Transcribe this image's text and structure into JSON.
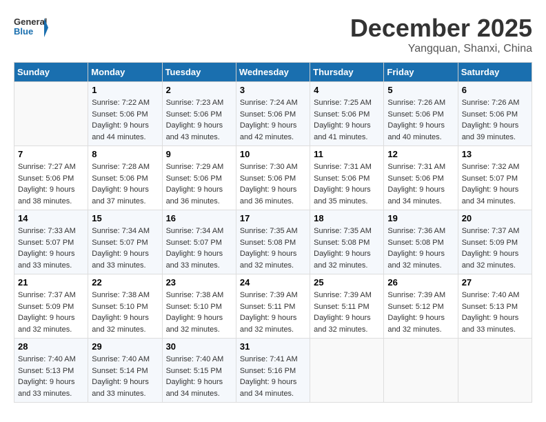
{
  "header": {
    "logo_general": "General",
    "logo_blue": "Blue",
    "month_title": "December 2025",
    "location": "Yangquan, Shanxi, China"
  },
  "days_of_week": [
    "Sunday",
    "Monday",
    "Tuesday",
    "Wednesday",
    "Thursday",
    "Friday",
    "Saturday"
  ],
  "weeks": [
    [
      {
        "day": "",
        "sunrise": "",
        "sunset": "",
        "daylight": ""
      },
      {
        "day": "1",
        "sunrise": "7:22 AM",
        "sunset": "5:06 PM",
        "daylight": "9 hours and 44 minutes."
      },
      {
        "day": "2",
        "sunrise": "7:23 AM",
        "sunset": "5:06 PM",
        "daylight": "9 hours and 43 minutes."
      },
      {
        "day": "3",
        "sunrise": "7:24 AM",
        "sunset": "5:06 PM",
        "daylight": "9 hours and 42 minutes."
      },
      {
        "day": "4",
        "sunrise": "7:25 AM",
        "sunset": "5:06 PM",
        "daylight": "9 hours and 41 minutes."
      },
      {
        "day": "5",
        "sunrise": "7:26 AM",
        "sunset": "5:06 PM",
        "daylight": "9 hours and 40 minutes."
      },
      {
        "day": "6",
        "sunrise": "7:26 AM",
        "sunset": "5:06 PM",
        "daylight": "9 hours and 39 minutes."
      }
    ],
    [
      {
        "day": "7",
        "sunrise": "7:27 AM",
        "sunset": "5:06 PM",
        "daylight": "9 hours and 38 minutes."
      },
      {
        "day": "8",
        "sunrise": "7:28 AM",
        "sunset": "5:06 PM",
        "daylight": "9 hours and 37 minutes."
      },
      {
        "day": "9",
        "sunrise": "7:29 AM",
        "sunset": "5:06 PM",
        "daylight": "9 hours and 36 minutes."
      },
      {
        "day": "10",
        "sunrise": "7:30 AM",
        "sunset": "5:06 PM",
        "daylight": "9 hours and 36 minutes."
      },
      {
        "day": "11",
        "sunrise": "7:31 AM",
        "sunset": "5:06 PM",
        "daylight": "9 hours and 35 minutes."
      },
      {
        "day": "12",
        "sunrise": "7:31 AM",
        "sunset": "5:06 PM",
        "daylight": "9 hours and 34 minutes."
      },
      {
        "day": "13",
        "sunrise": "7:32 AM",
        "sunset": "5:07 PM",
        "daylight": "9 hours and 34 minutes."
      }
    ],
    [
      {
        "day": "14",
        "sunrise": "7:33 AM",
        "sunset": "5:07 PM",
        "daylight": "9 hours and 33 minutes."
      },
      {
        "day": "15",
        "sunrise": "7:34 AM",
        "sunset": "5:07 PM",
        "daylight": "9 hours and 33 minutes."
      },
      {
        "day": "16",
        "sunrise": "7:34 AM",
        "sunset": "5:07 PM",
        "daylight": "9 hours and 33 minutes."
      },
      {
        "day": "17",
        "sunrise": "7:35 AM",
        "sunset": "5:08 PM",
        "daylight": "9 hours and 32 minutes."
      },
      {
        "day": "18",
        "sunrise": "7:35 AM",
        "sunset": "5:08 PM",
        "daylight": "9 hours and 32 minutes."
      },
      {
        "day": "19",
        "sunrise": "7:36 AM",
        "sunset": "5:08 PM",
        "daylight": "9 hours and 32 minutes."
      },
      {
        "day": "20",
        "sunrise": "7:37 AM",
        "sunset": "5:09 PM",
        "daylight": "9 hours and 32 minutes."
      }
    ],
    [
      {
        "day": "21",
        "sunrise": "7:37 AM",
        "sunset": "5:09 PM",
        "daylight": "9 hours and 32 minutes."
      },
      {
        "day": "22",
        "sunrise": "7:38 AM",
        "sunset": "5:10 PM",
        "daylight": "9 hours and 32 minutes."
      },
      {
        "day": "23",
        "sunrise": "7:38 AM",
        "sunset": "5:10 PM",
        "daylight": "9 hours and 32 minutes."
      },
      {
        "day": "24",
        "sunrise": "7:39 AM",
        "sunset": "5:11 PM",
        "daylight": "9 hours and 32 minutes."
      },
      {
        "day": "25",
        "sunrise": "7:39 AM",
        "sunset": "5:11 PM",
        "daylight": "9 hours and 32 minutes."
      },
      {
        "day": "26",
        "sunrise": "7:39 AM",
        "sunset": "5:12 PM",
        "daylight": "9 hours and 32 minutes."
      },
      {
        "day": "27",
        "sunrise": "7:40 AM",
        "sunset": "5:13 PM",
        "daylight": "9 hours and 33 minutes."
      }
    ],
    [
      {
        "day": "28",
        "sunrise": "7:40 AM",
        "sunset": "5:13 PM",
        "daylight": "9 hours and 33 minutes."
      },
      {
        "day": "29",
        "sunrise": "7:40 AM",
        "sunset": "5:14 PM",
        "daylight": "9 hours and 33 minutes."
      },
      {
        "day": "30",
        "sunrise": "7:40 AM",
        "sunset": "5:15 PM",
        "daylight": "9 hours and 34 minutes."
      },
      {
        "day": "31",
        "sunrise": "7:41 AM",
        "sunset": "5:16 PM",
        "daylight": "9 hours and 34 minutes."
      },
      {
        "day": "",
        "sunrise": "",
        "sunset": "",
        "daylight": ""
      },
      {
        "day": "",
        "sunrise": "",
        "sunset": "",
        "daylight": ""
      },
      {
        "day": "",
        "sunrise": "",
        "sunset": "",
        "daylight": ""
      }
    ]
  ],
  "labels": {
    "sunrise": "Sunrise:",
    "sunset": "Sunset:",
    "daylight": "Daylight:"
  }
}
